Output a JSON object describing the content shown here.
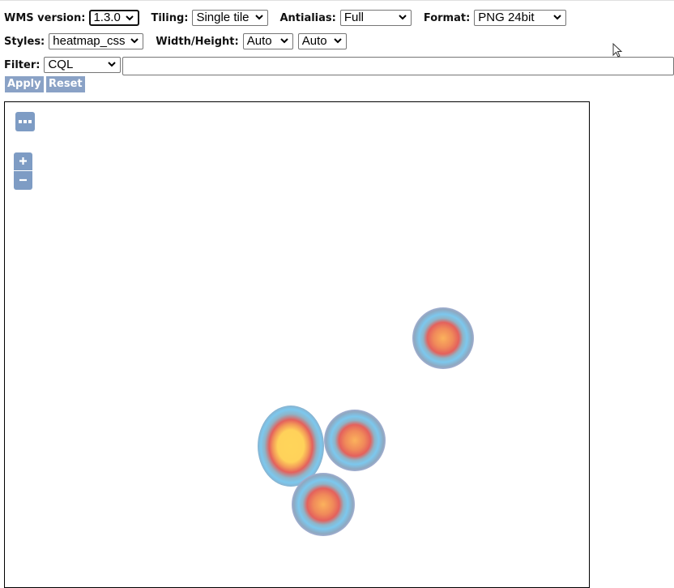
{
  "toolbar": {
    "wms_version": {
      "label": "WMS version:",
      "value": "1.3.0"
    },
    "tiling": {
      "label": "Tiling:",
      "value": "Single tile"
    },
    "antialias": {
      "label": "Antialias:",
      "value": "Full"
    },
    "format": {
      "label": "Format:",
      "value": "PNG 24bit"
    },
    "styles": {
      "label": "Styles:",
      "value": "heatmap_css"
    },
    "width_height": {
      "label": "Width/Height:",
      "width_value": "Auto",
      "height_value": "Auto"
    },
    "filter": {
      "label": "Filter:",
      "type_value": "CQL",
      "expression": ""
    },
    "apply_label": "Apply",
    "reset_label": "Reset"
  },
  "map": {
    "controls": {
      "layer_switcher": "more-options-icon",
      "zoom_in": "+",
      "zoom_out": "−"
    },
    "heatmap_spots": [
      {
        "name": "hotspot-northeast",
        "intensity": "medium"
      },
      {
        "name": "hotspot-west-large",
        "intensity": "high"
      },
      {
        "name": "hotspot-center",
        "intensity": "medium"
      },
      {
        "name": "hotspot-south",
        "intensity": "medium"
      }
    ]
  },
  "colors": {
    "control_blue": "#7e9cc4",
    "button_blue": "#8aa2c6",
    "heat_yellow": "#ffd35a",
    "heat_red": "#e8665a",
    "heat_cyan": "#7cc8ee",
    "heat_lavender": "#b9b6e6"
  }
}
